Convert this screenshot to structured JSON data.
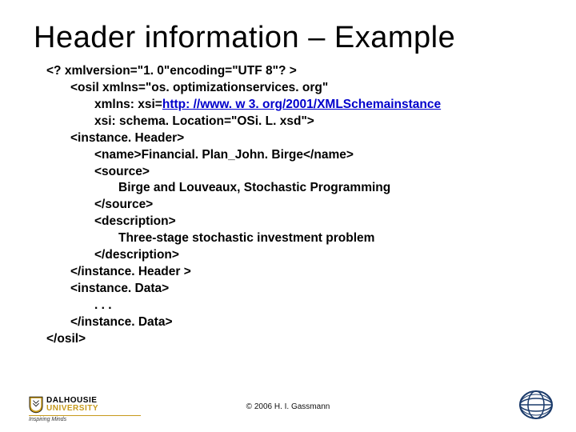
{
  "title": "Header information – Example",
  "code": {
    "l1": "<? xmlversion=\"1. 0\"encoding=\"UTF 8\"? >",
    "l2a": "<osil xmlns=\"os. optimizationservices. org\"",
    "l2b_pre": "xmlns: xsi=",
    "l2b_link": "http: //www. w 3. org/2001/XMLSchemainstance",
    "l2c": "xsi: schema. Location=\"OSi. L. xsd\">",
    "l3": "<instance. Header>",
    "l4": "<name>Financial. Plan_John. Birge</name>",
    "l5": "<source>",
    "l6": "Birge and Louveaux, Stochastic Programming",
    "l7": "</source>",
    "l8": "<description>",
    "l9": "Three-stage stochastic investment problem",
    "l10": "</description>",
    "l11": "</instance. Header >",
    "l12": "<instance. Data>",
    "l13": ". . .",
    "l14": "</instance. Data>",
    "l15": "</osil>"
  },
  "footer": {
    "copyright": "© 2006 H. I. Gassmann",
    "logo_left": {
      "dal": "DALHOUSIE",
      "uni": "UNIVERSITY",
      "motto": "Inspiring Minds"
    }
  }
}
